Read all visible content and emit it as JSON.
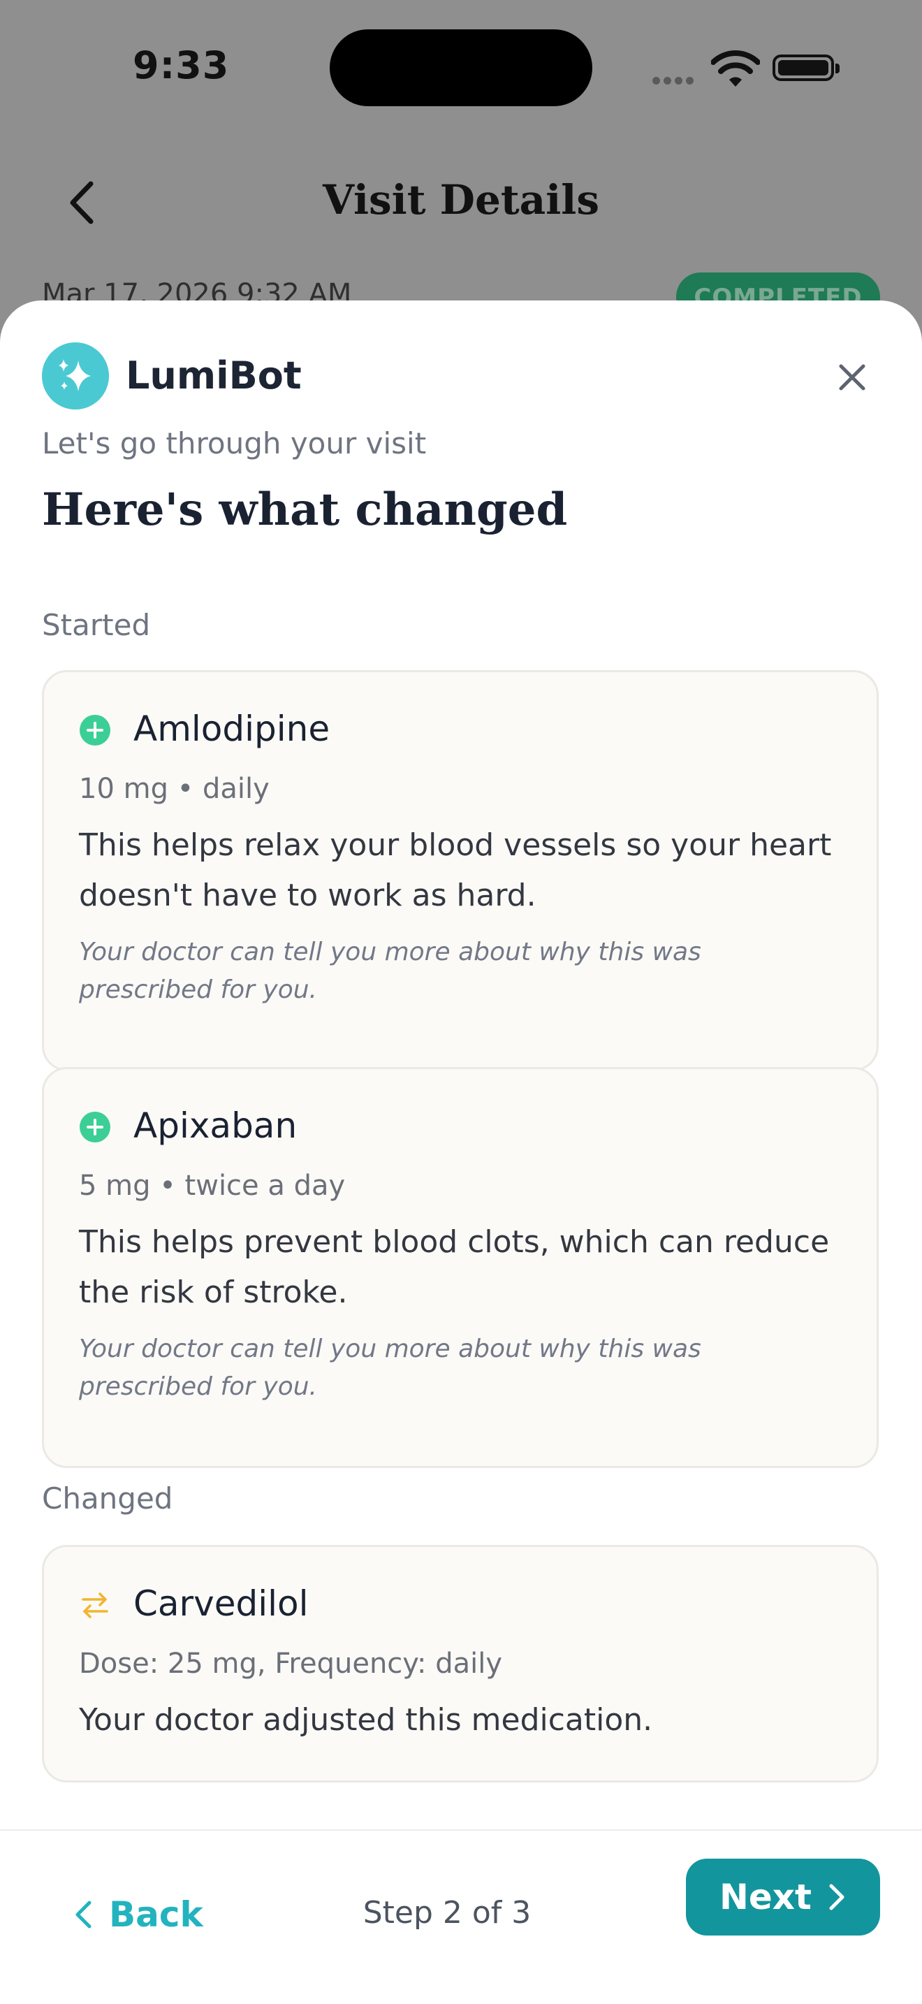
{
  "status_bar": {
    "time": "9:33"
  },
  "background_screen": {
    "title": "Visit Details",
    "date": "Mar 17, 2026 9:32 AM",
    "badge": "COMPLETED"
  },
  "sheet": {
    "bot_name": "LumiBot",
    "subtitle": "Let's go through your visit",
    "heading": "Here's what changed",
    "sections": {
      "started_label": "Started",
      "changed_label": "Changed"
    },
    "started": [
      {
        "name": "Amlodipine",
        "dose": "10 mg • daily",
        "description": "This helps relax your blood vessels so your heart doesn't have to work as hard.",
        "note": "Your doctor can tell you more about why this was prescribed for you."
      },
      {
        "name": "Apixaban",
        "dose": "5 mg • twice a day",
        "description": "This helps prevent blood clots, which can reduce the risk of stroke.",
        "note": "Your doctor can tell you more about why this was prescribed for you."
      }
    ],
    "changed": [
      {
        "name": "Carvedilol",
        "dose": "Dose: 25 mg, Frequency: daily",
        "description": "Your doctor adjusted this medication."
      }
    ]
  },
  "footer": {
    "back_label": "Back",
    "step_text": "Step 2 of 3",
    "next_label": "Next"
  },
  "colors": {
    "accent": "#13959d",
    "accent_light": "#23b3be",
    "started_icon": "#3ccf95",
    "changed_icon": "#f1b52f",
    "bot_avatar": "#4bc9d2"
  },
  "icons": {
    "back_arrow": "chevron-left-icon",
    "close": "close-icon",
    "bot": "sparkle-icon",
    "started": "plus-circle-icon",
    "changed": "swap-arrows-icon",
    "next": "chevron-right-icon"
  }
}
